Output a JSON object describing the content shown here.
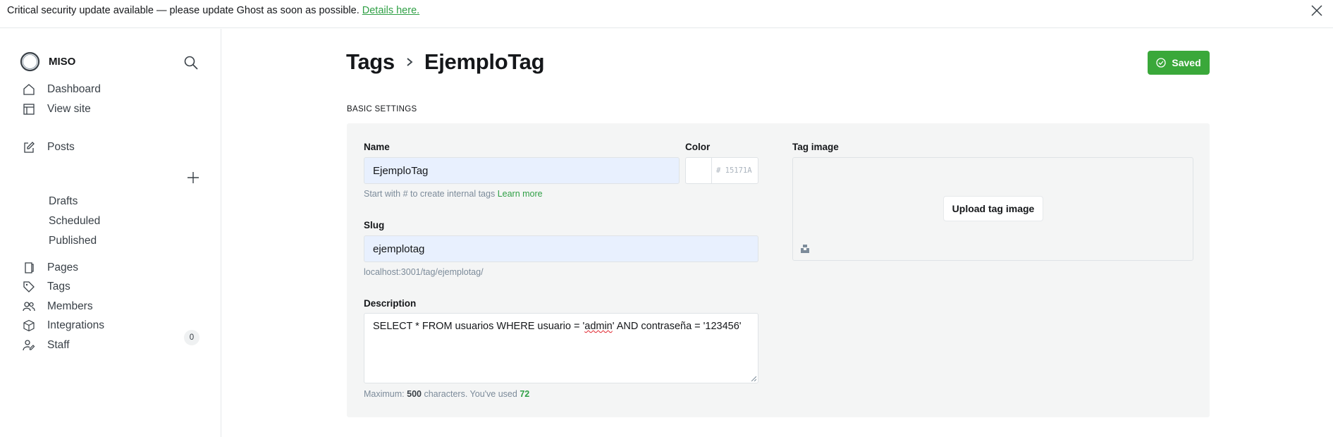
{
  "banner": {
    "message": "Critical security update available — please update Ghost as soon as possible.",
    "link_text": "Details here."
  },
  "sidebar": {
    "site_name": "MISO",
    "nav": [
      {
        "label": "Dashboard",
        "icon": "home-icon"
      },
      {
        "label": "View site",
        "icon": "layout-icon"
      },
      {
        "label": "Posts",
        "icon": "edit-icon"
      },
      {
        "label": "Pages",
        "icon": "page-icon"
      },
      {
        "label": "Tags",
        "icon": "tag-icon"
      },
      {
        "label": "Members",
        "icon": "members-icon"
      },
      {
        "label": "Integrations",
        "icon": "box-icon"
      },
      {
        "label": "Staff",
        "icon": "staff-icon"
      }
    ],
    "posts_sub": [
      "Drafts",
      "Scheduled",
      "Published"
    ],
    "members_count": "0"
  },
  "header": {
    "breadcrumb_parent": "Tags",
    "breadcrumb_current": "EjemploTag",
    "saved_label": "Saved"
  },
  "basic_settings": {
    "section_title": "BASIC SETTINGS",
    "name_label": "Name",
    "name_value": "EjemploTag",
    "name_hint": "Start with # to create internal tags",
    "learn_more": "Learn more",
    "color_label": "Color",
    "color_value": "# 15171A",
    "slug_label": "Slug",
    "slug_value": "ejemplotag",
    "slug_url": "localhost:3001/tag/ejemplotag/",
    "description_label": "Description",
    "description_value_before": "SELECT * FROM usuarios WHERE usuario = '",
    "description_value_misspelled": "admin",
    "description_value_after": "' AND contraseña = '123456'",
    "max_prefix": "Maximum:",
    "max_chars": "500",
    "max_middle": "characters. You've used",
    "used_chars": "72",
    "tag_image_label": "Tag image",
    "upload_label": "Upload tag image"
  },
  "colors": {
    "accent_green": "#3aa83a",
    "panel_bg": "#f4f5f5",
    "autofill_bg": "#e8f0fe"
  }
}
